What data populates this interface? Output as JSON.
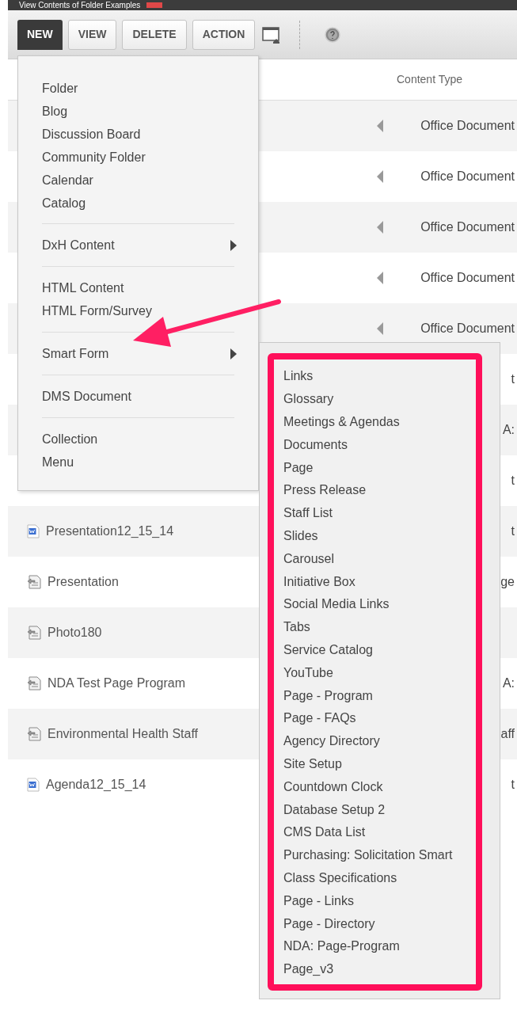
{
  "window": {
    "title": "View Contents of Folder Examples"
  },
  "toolbar": {
    "buttons": [
      {
        "label": "NEW",
        "selected": true
      },
      {
        "label": "VIEW",
        "selected": false
      },
      {
        "label": "DELETE",
        "selected": false
      },
      {
        "label": "ACTION",
        "selected": false
      }
    ]
  },
  "table": {
    "columns": [
      "Content Type"
    ],
    "rows": [
      {
        "arrow": true,
        "content_type": "Office Document"
      },
      {
        "arrow": true,
        "content_type": "Office Document"
      },
      {
        "arrow": true,
        "content_type": "Office Document"
      },
      {
        "arrow": true,
        "content_type": "Office Document"
      },
      {
        "arrow": true,
        "content_type": "Office Document"
      },
      {
        "content_type": "t"
      },
      {
        "content_type": "A:"
      },
      {
        "content_type": "t"
      },
      {
        "kind": "word",
        "name": "Presentation12_15_14",
        "content_type": "t"
      },
      {
        "kind": "page",
        "name": "Presentation",
        "content_type": "ge"
      },
      {
        "kind": "page",
        "name": "Photo180"
      },
      {
        "kind": "page",
        "name": "NDA Test Page Program",
        "content_type": "A:"
      },
      {
        "kind": "page",
        "name": "Environmental Health Staff",
        "content_type": "aff"
      },
      {
        "kind": "word",
        "name": "Agenda12_15_14",
        "content_type": "t"
      }
    ]
  },
  "new_menu": {
    "groups": [
      [
        {
          "label": "Folder",
          "submenu": false
        },
        {
          "label": "Blog",
          "submenu": false
        },
        {
          "label": "Discussion Board",
          "submenu": false
        },
        {
          "label": "Community Folder",
          "submenu": false
        },
        {
          "label": "Calendar",
          "submenu": false
        },
        {
          "label": "Catalog",
          "submenu": false
        }
      ],
      [
        {
          "label": "DxH Content",
          "submenu": true
        }
      ],
      [
        {
          "label": "HTML Content",
          "submenu": false
        },
        {
          "label": "HTML Form/Survey",
          "submenu": false
        }
      ],
      [
        {
          "label": "Smart Form",
          "submenu": true
        }
      ],
      [
        {
          "label": "DMS Document",
          "submenu": false
        }
      ],
      [
        {
          "label": "Collection",
          "submenu": false
        },
        {
          "label": "Menu",
          "submenu": false
        }
      ]
    ]
  },
  "smart_form_menu": {
    "items": [
      "Links",
      "Glossary",
      "Meetings & Agendas",
      "Documents",
      "Page",
      "Press Release",
      "Staff List",
      "Slides",
      "Carousel",
      "Initiative Box",
      "Social Media Links",
      "Tabs",
      "Service Catalog",
      "YouTube",
      "Page - Program",
      "Page - FAQs",
      "Agency Directory",
      "Site Setup",
      "Countdown Clock",
      "Database Setup 2",
      "CMS Data List",
      "Purchasing: Solicitation Smart",
      "Class Specifications",
      "Page - Links",
      "Page - Directory",
      "NDA: Page-Program",
      "Page_v3"
    ]
  }
}
